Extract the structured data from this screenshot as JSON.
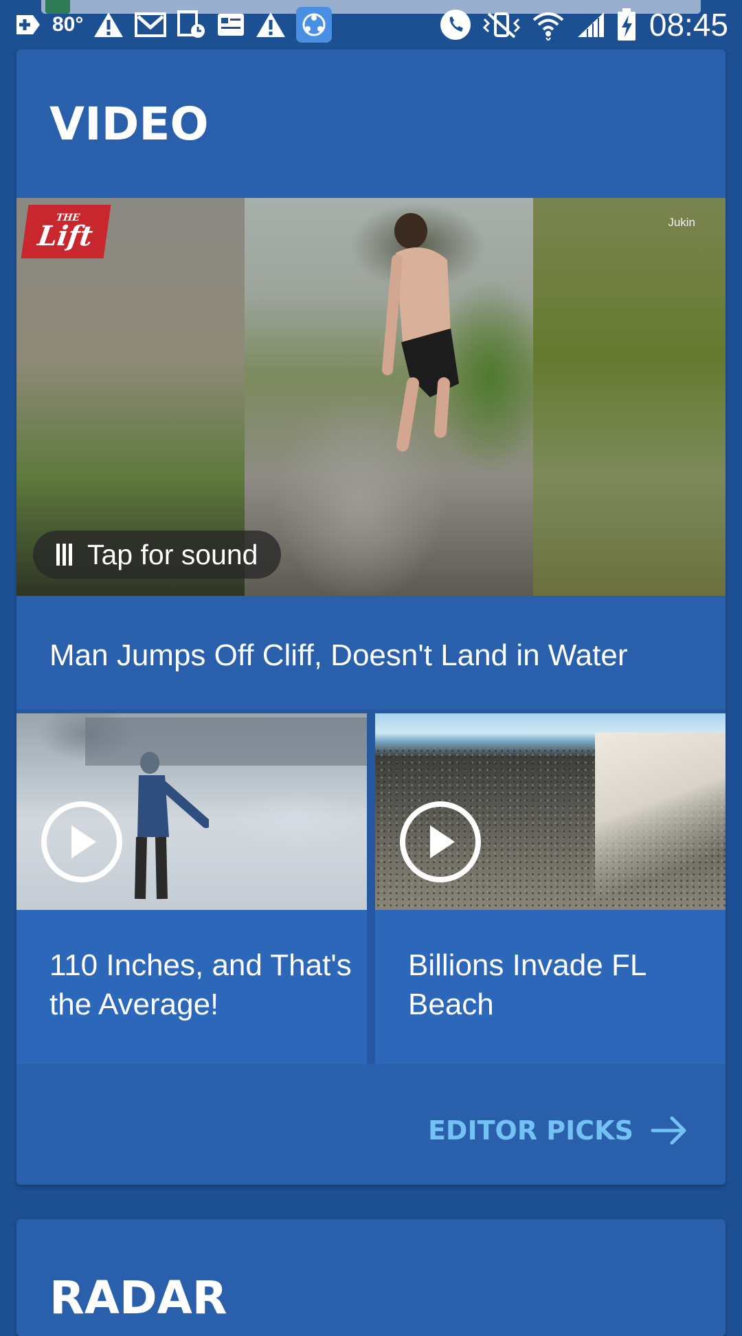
{
  "status_bar": {
    "temperature": "80°",
    "time": "08:45",
    "icons": [
      "add-icon",
      "warning-icon",
      "gmail-icon",
      "calendar-icon",
      "news-icon",
      "warning-icon",
      "shareit-icon",
      "phone-icon",
      "vibrate-icon",
      "wifi-icon",
      "signal-icon",
      "battery-charging-icon"
    ]
  },
  "video_section": {
    "title": "VIDEO",
    "hero": {
      "brand_small": "THE",
      "brand_big": "Lift",
      "watermark": "Jukin",
      "sound_label": "Tap for sound",
      "title": "Man Jumps Off Cliff, Doesn't Land in Water"
    },
    "tiles": [
      {
        "title": "110 Inches, and That's the Average!"
      },
      {
        "title": "Billions Invade FL Beach"
      }
    ],
    "editor_picks_label": "EDITOR PICKS"
  },
  "radar_section": {
    "title": "RADAR"
  },
  "colors": {
    "background": "#1d4f93",
    "card": "#2a60ab",
    "tile": "#2d67b9",
    "link": "#74c1f5",
    "brand_red": "#c8272d"
  }
}
